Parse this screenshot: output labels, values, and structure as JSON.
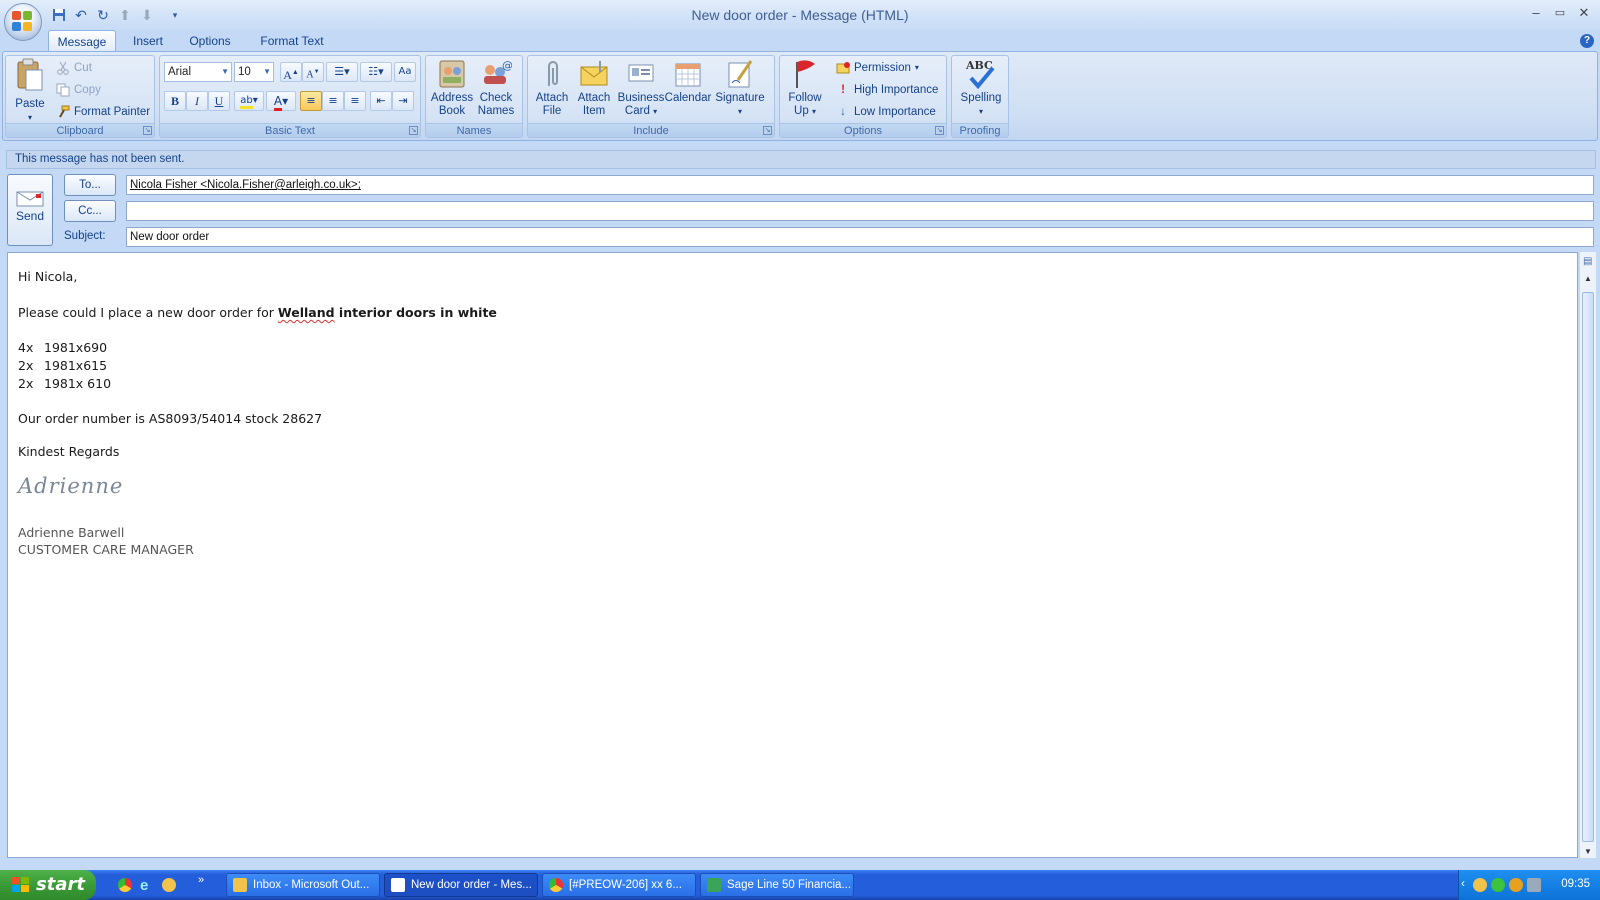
{
  "window": {
    "title": "New door order - Message (HTML)"
  },
  "tabs": [
    "Message",
    "Insert",
    "Options",
    "Format Text"
  ],
  "ribbon": {
    "clipboard": {
      "label": "Clipboard",
      "paste": "Paste",
      "cut": "Cut",
      "copy": "Copy",
      "format_painter": "Format Painter"
    },
    "basic_text": {
      "label": "Basic Text",
      "font": "Arial",
      "size": "10"
    },
    "names": {
      "label": "Names",
      "address_book": [
        "Address",
        "Book"
      ],
      "check_names": [
        "Check",
        "Names"
      ]
    },
    "include": {
      "label": "Include",
      "attach_file": [
        "Attach",
        "File"
      ],
      "attach_item": [
        "Attach",
        "Item"
      ],
      "business_card": [
        "Business",
        "Card"
      ],
      "calendar": "Calendar",
      "signature": "Signature"
    },
    "options": {
      "label": "Options",
      "follow_up": [
        "Follow",
        "Up"
      ],
      "permission": "Permission",
      "high_importance": "High Importance",
      "low_importance": "Low Importance"
    },
    "proofing": {
      "label": "Proofing",
      "spelling": "Spelling",
      "abc": "ABC"
    }
  },
  "infobar": "This message has not been sent.",
  "header": {
    "send": "Send",
    "to_button": "To...",
    "cc_button": "Cc...",
    "subject_label": "Subject:",
    "to_value": "Nicola Fisher <Nicola.Fisher@arleigh.co.uk>;",
    "cc_value": "",
    "subject_value": "New door order"
  },
  "message": {
    "greeting": "Hi Nicola,",
    "intro": "Please could I place a new door order for ",
    "product_brand": "Welland",
    "product_rest": " interior doors in white",
    "items": [
      {
        "qty": "4x",
        "size": "1981x690"
      },
      {
        "qty": "2x",
        "size": "1981x615"
      },
      {
        "qty": "2x",
        "size": "1981x 610"
      }
    ],
    "order_line": "Our order number is  AS8093/54014 stock 28627",
    "closing": "Kindest Regards",
    "signature_script": "Adrienne",
    "sender_name": "Adrienne Barwell",
    "sender_title": "CUSTOMER CARE MANAGER"
  },
  "taskbar": {
    "start": "start",
    "tasks": [
      {
        "label": "Inbox - Microsoft Out...",
        "active": false,
        "color": "#f2c34a"
      },
      {
        "label": "New door order - Mes...",
        "active": true,
        "color": "#ffffff"
      },
      {
        "label": "[#PREOW-206] xx 6...",
        "active": false,
        "color": "#e8453c"
      },
      {
        "label": "Sage Line 50 Financia...",
        "active": false,
        "color": "#3aa55a"
      }
    ],
    "clock": "09:35"
  },
  "colors": {
    "ribbon_text": "#15428b",
    "taskbar": "#245edb",
    "start": "#3a9b36"
  }
}
